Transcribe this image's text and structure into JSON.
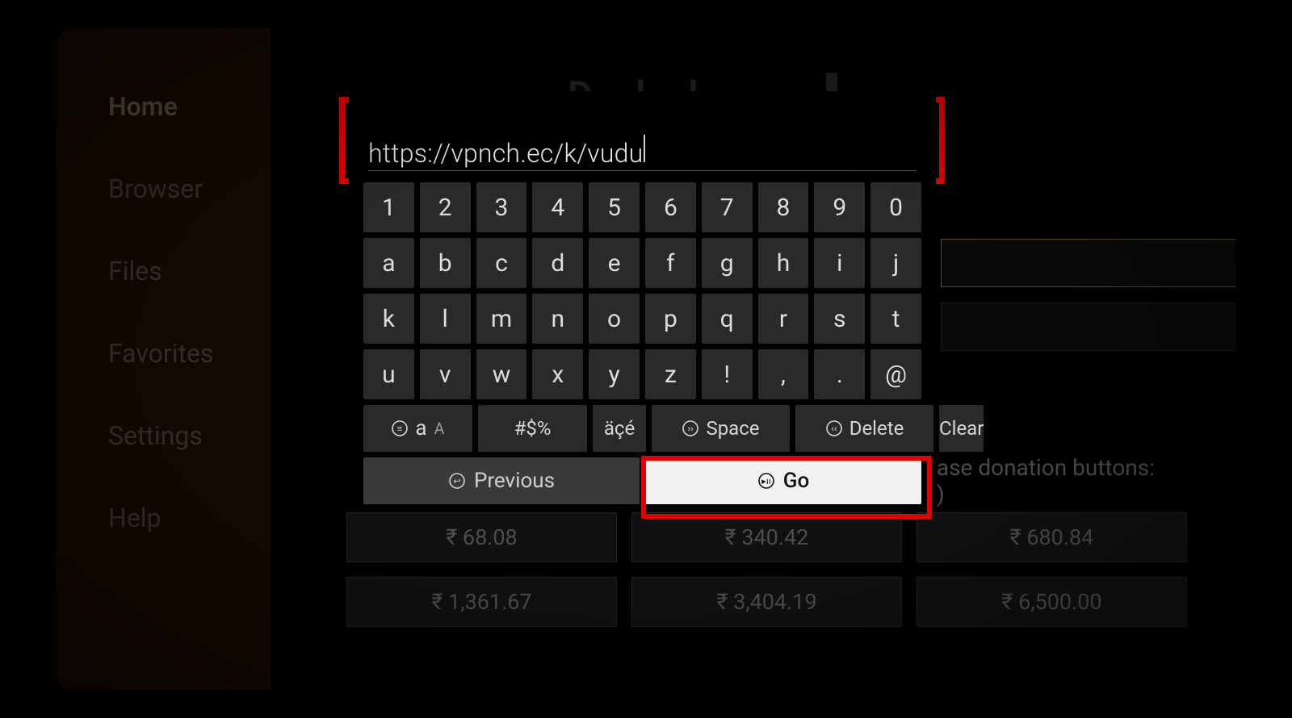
{
  "sidebar": {
    "items": [
      {
        "label": "Home",
        "active": true
      },
      {
        "label": "Browser",
        "active": false
      },
      {
        "label": "Files",
        "active": false
      },
      {
        "label": "Favorites",
        "active": false
      },
      {
        "label": "Settings",
        "active": false
      },
      {
        "label": "Help",
        "active": false
      }
    ]
  },
  "background": {
    "donation_text_fragment": "ase donation buttons:",
    "donation_paren": ")",
    "buttons": [
      "₹ 68.08",
      "₹ 340.42",
      "₹ 680.84",
      "₹ 1,361.67",
      "₹ 3,404.19",
      "₹ 6,500.00"
    ]
  },
  "modal": {
    "url_value": "https://vpnch.ec/k/vudu",
    "keys": [
      "1",
      "2",
      "3",
      "4",
      "5",
      "6",
      "7",
      "8",
      "9",
      "0",
      "a",
      "b",
      "c",
      "d",
      "e",
      "f",
      "g",
      "h",
      "i",
      "j",
      "k",
      "l",
      "m",
      "n",
      "o",
      "p",
      "q",
      "r",
      "s",
      "t",
      "u",
      "v",
      "w",
      "x",
      "y",
      "z",
      "!",
      ",",
      ".",
      "@"
    ],
    "func": {
      "case_label_a": "a",
      "case_label_A": "A",
      "symbols": "#$%",
      "accents": "äçé",
      "space": "Space",
      "delete": "Delete",
      "clear": "Clear"
    },
    "nav": {
      "previous": "Previous",
      "go": "Go"
    }
  }
}
